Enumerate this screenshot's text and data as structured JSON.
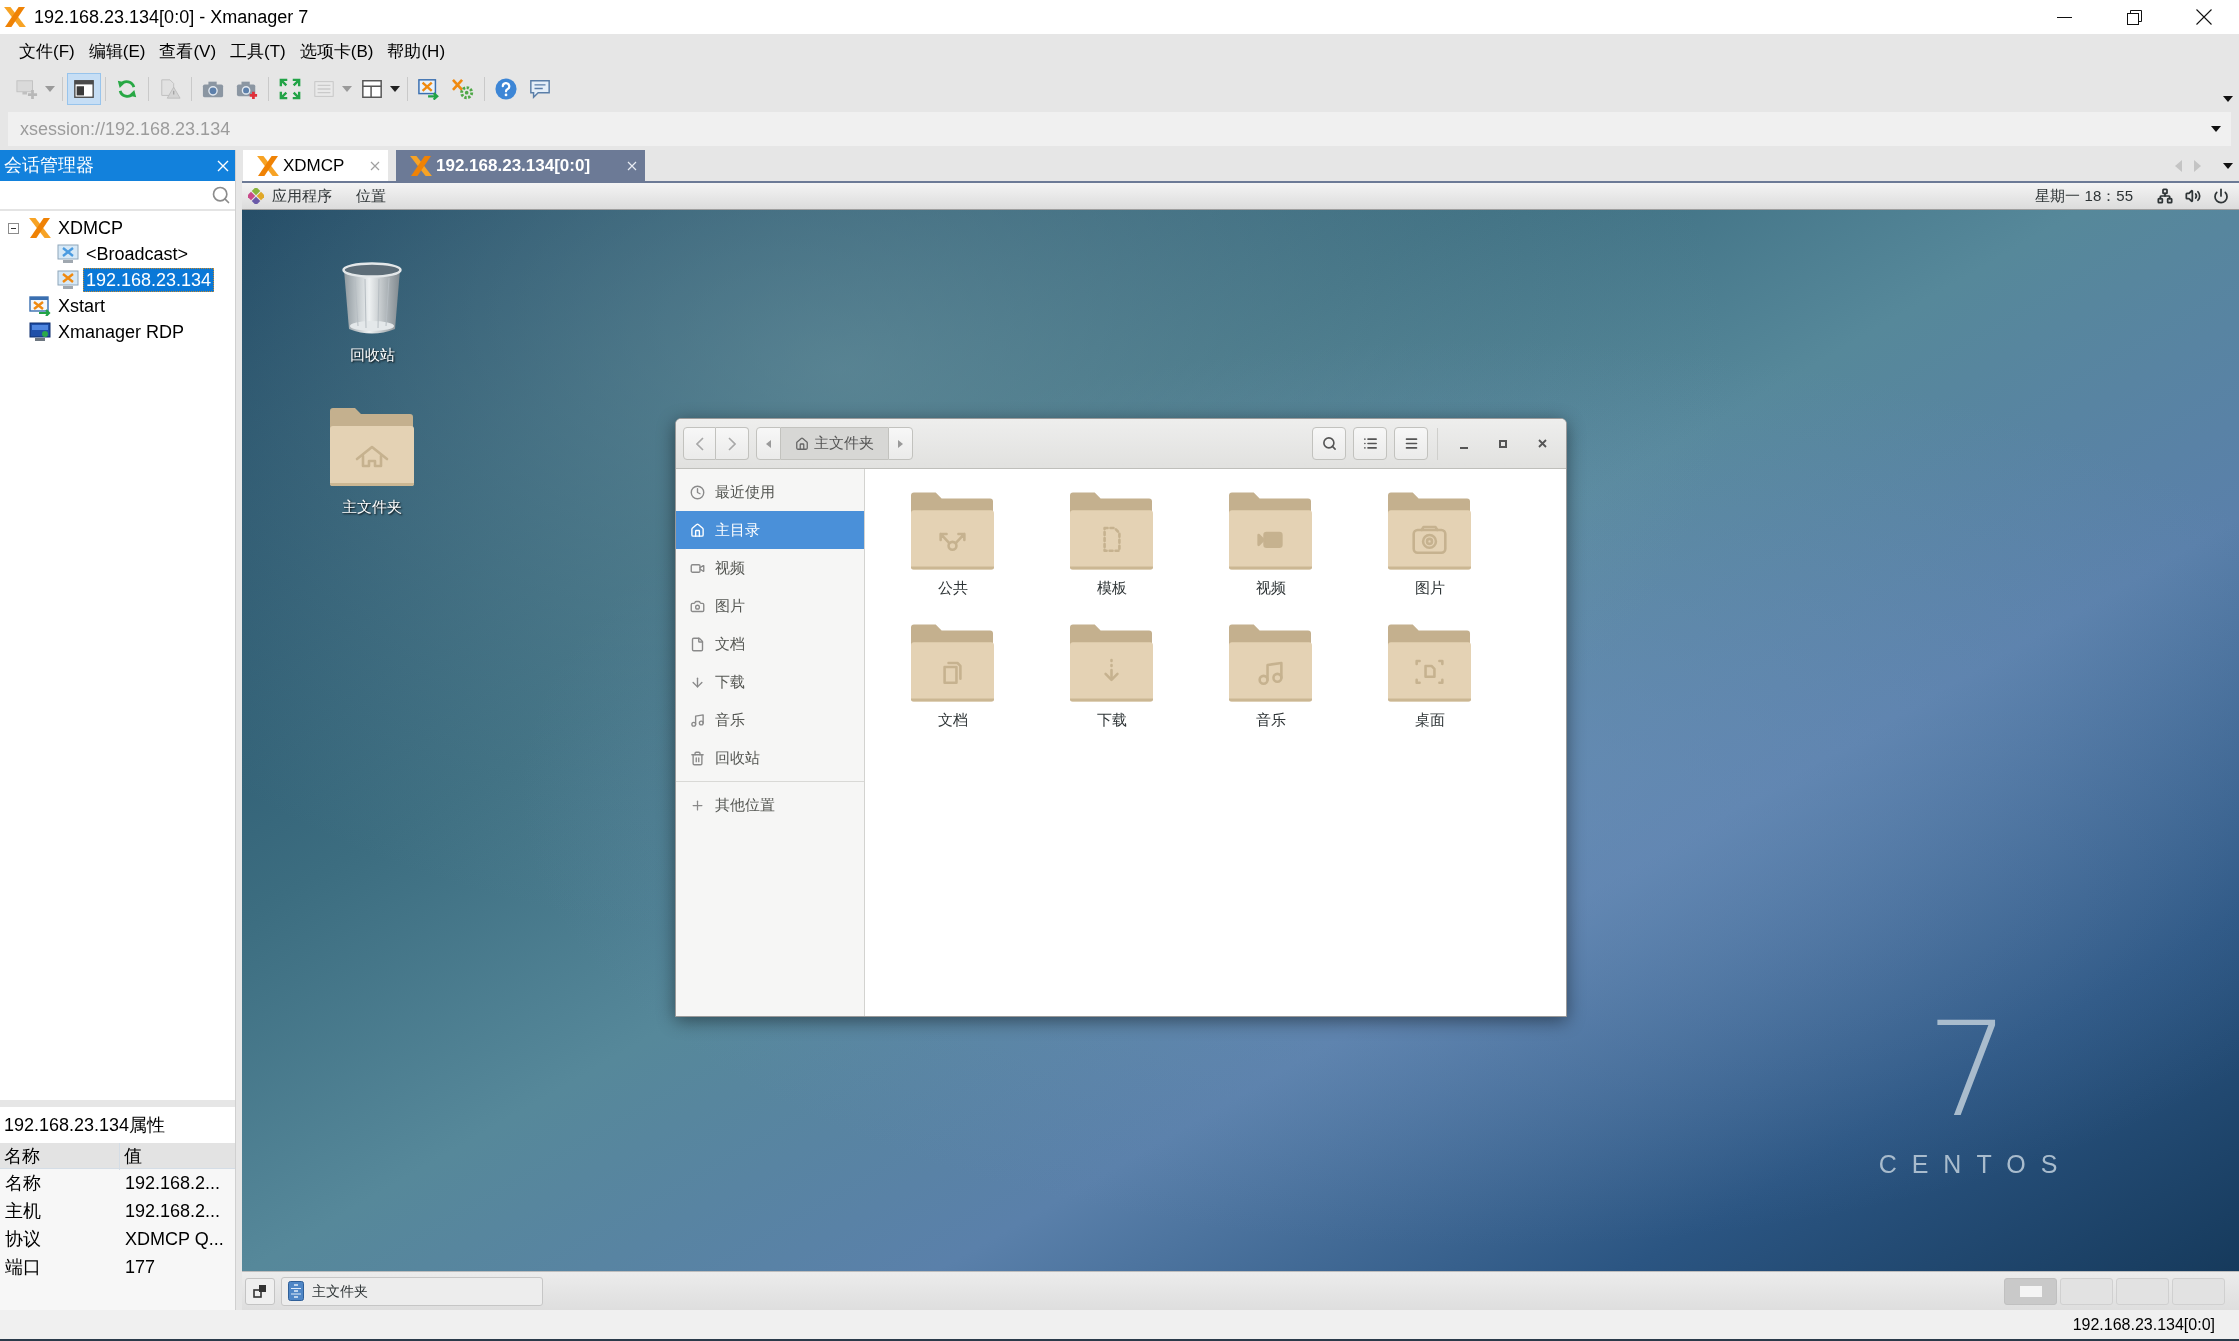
{
  "window": {
    "title": "192.168.23.134[0:0] - Xmanager 7"
  },
  "menu_bar": [
    "文件(F)",
    "编辑(E)",
    "查看(V)",
    "工具(T)",
    "选项卡(B)",
    "帮助(H)"
  ],
  "toolbar": [
    [
      {
        "kind": "new",
        "dropdown": true,
        "on": false,
        "disabled": true
      }
    ],
    [
      {
        "kind": "panel",
        "dropdown": false,
        "on": true,
        "disabled": false
      }
    ],
    [
      {
        "kind": "refresh",
        "dropdown": false,
        "on": false,
        "disabled": false
      }
    ],
    [
      {
        "kind": "alert",
        "dropdown": false,
        "on": false,
        "disabled": true
      }
    ],
    [
      {
        "kind": "camera",
        "dropdown": false,
        "on": false,
        "disabled": false
      },
      {
        "kind": "record",
        "dropdown": false,
        "on": false,
        "disabled": false
      }
    ],
    [
      {
        "kind": "fullscreen",
        "dropdown": false,
        "on": false,
        "disabled": false
      },
      {
        "kind": "list",
        "dropdown": true,
        "on": false,
        "disabled": true
      },
      {
        "kind": "layout",
        "dropdown": true,
        "on": false,
        "disabled": false
      }
    ],
    [
      {
        "kind": "launch",
        "dropdown": false,
        "on": false,
        "disabled": false
      },
      {
        "kind": "settings",
        "dropdown": false,
        "on": false,
        "disabled": false
      }
    ],
    [
      {
        "kind": "help",
        "dropdown": false,
        "on": false,
        "disabled": false
      },
      {
        "kind": "chat",
        "dropdown": false,
        "on": false,
        "disabled": false
      }
    ]
  ],
  "address_bar": {
    "value": "xsession://192.168.23.134"
  },
  "session_manager": {
    "title": "会话管理器",
    "tree": [
      {
        "label": "XDMCP",
        "kind": "xdmcp",
        "selected": false,
        "expanded": true,
        "children": [
          {
            "label": "<Broadcast>",
            "kind": "broadcast",
            "selected": false
          },
          {
            "label": "192.168.23.134",
            "kind": "host",
            "selected": true
          }
        ]
      },
      {
        "label": "Xstart",
        "kind": "xstart",
        "selected": false
      },
      {
        "label": "Xmanager RDP",
        "kind": "rdp",
        "selected": false
      }
    ],
    "properties": {
      "title": "192.168.23.134属性",
      "columns": [
        "名称",
        "值"
      ],
      "rows": [
        [
          "名称",
          "192.168.2..."
        ],
        [
          "主机",
          "192.168.2..."
        ],
        [
          "协议",
          "XDMCP Q..."
        ],
        [
          "端口",
          "177"
        ]
      ]
    }
  },
  "tabs": [
    {
      "label": "XDMCP",
      "selected": false
    },
    {
      "label": "192.168.23.134[0:0]",
      "selected": true
    }
  ],
  "remote_desktop": {
    "top_bar": {
      "menus": [
        "应用程序",
        "位置"
      ],
      "clock": "星期一 18：55"
    },
    "desktop_icons": [
      {
        "label": "回收站",
        "kind": "trash"
      },
      {
        "label": "主文件夹",
        "kind": "home"
      }
    ],
    "file_manager": {
      "path": "主文件夹",
      "sidebar": [
        {
          "label": "最近使用",
          "kind": "recent",
          "selected": false
        },
        {
          "label": "主目录",
          "kind": "home",
          "selected": true
        },
        {
          "label": "视频",
          "kind": "videos",
          "selected": false
        },
        {
          "label": "图片",
          "kind": "pictures",
          "selected": false
        },
        {
          "label": "文档",
          "kind": "documents",
          "selected": false
        },
        {
          "label": "下载",
          "kind": "downloads",
          "selected": false
        },
        {
          "label": "音乐",
          "kind": "music",
          "selected": false
        },
        {
          "label": "回收站",
          "kind": "trash",
          "selected": false
        }
      ],
      "other_locations": "其他位置",
      "folders": [
        {
          "label": "公共",
          "kind": "public"
        },
        {
          "label": "模板",
          "kind": "templates"
        },
        {
          "label": "视频",
          "kind": "videos"
        },
        {
          "label": "图片",
          "kind": "pictures"
        },
        {
          "label": "文档",
          "kind": "documents"
        },
        {
          "label": "下载",
          "kind": "downloads"
        },
        {
          "label": "音乐",
          "kind": "music"
        },
        {
          "label": "桌面",
          "kind": "desktop"
        }
      ]
    },
    "wallpaper_logo": {
      "numeral": "7",
      "name": "CENTOS"
    },
    "bottom_panel": {
      "windows": [
        "主文件夹"
      ],
      "workspaces": [
        {
          "selected": true
        },
        {
          "selected": false
        },
        {
          "selected": false
        },
        {
          "selected": false
        }
      ]
    }
  },
  "status_bar": {
    "text": "192.168.23.134[0:0]"
  }
}
